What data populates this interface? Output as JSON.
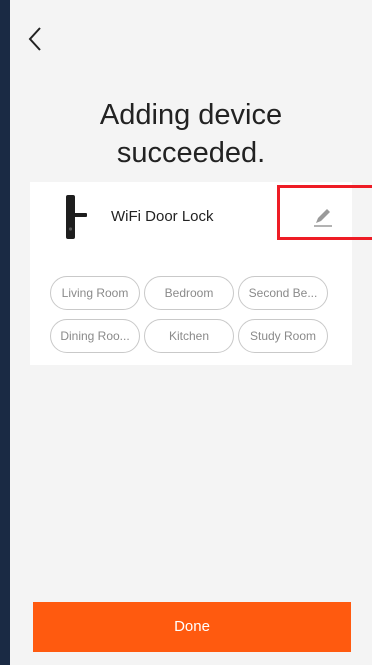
{
  "header": {
    "title_line1": "Adding device",
    "title_line2": "succeeded."
  },
  "device": {
    "name": "WiFi Door Lock",
    "icon": "door-lock-icon"
  },
  "rooms": [
    {
      "label": "Living Room"
    },
    {
      "label": "Bedroom"
    },
    {
      "label": "Second Be..."
    },
    {
      "label": "Dining Roo..."
    },
    {
      "label": "Kitchen"
    },
    {
      "label": "Study Room"
    }
  ],
  "footer": {
    "done_label": "Done"
  },
  "colors": {
    "accent": "#ff5a0f",
    "highlight": "#ee1c25",
    "background": "#f4f4f4"
  }
}
